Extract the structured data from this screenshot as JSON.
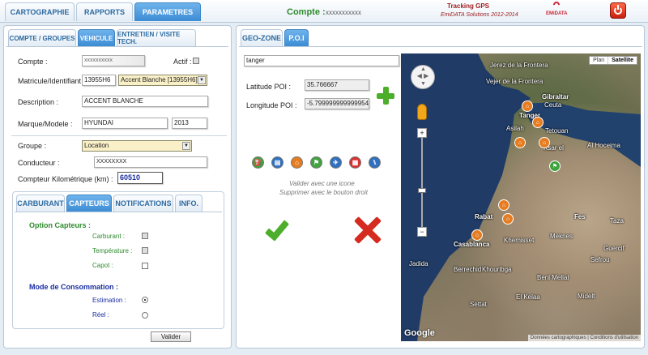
{
  "nav": {
    "tabs": [
      "CARTOGRAPHIE",
      "RAPPORTS",
      "PARAMETRES"
    ],
    "compte_label": "Compte :",
    "compte_value": "xxxxxxxxxxx",
    "tracking_title": "Tracking GPS",
    "tracking_sub": "EmiDATA Solutions 2012-2014",
    "logo_text": "EMiDATA"
  },
  "left": {
    "tabs": [
      "COMPTE / GROUPES",
      "VEHICULE",
      "ENTRETIEN / VISITE TECH."
    ],
    "compte_label": "Compte :",
    "compte_value": "xxxxxxxxxx",
    "actif_label": "Actif :",
    "matricule_label": "Matricule/Identifiant :",
    "matricule_value": "13955H6",
    "vehicule_select": "Accent Blanche [13955H6]",
    "description_label": "Description :",
    "description_value": "ACCENT BLANCHE",
    "marque_label": "Marque/Modele :",
    "marque_value": "HYUNDAI",
    "annee_value": "2013",
    "groupe_label": "Groupe :",
    "groupe_value": "Location",
    "conducteur_label": "Conducteur :",
    "conducteur_value": "XXXXXXXX",
    "compteur_label": "Compteur Kilométrique (km) :",
    "compteur_value": "60510",
    "subtabs": [
      "CARBURANT",
      "CAPTEURS",
      "NOTIFICATIONS",
      "INFO."
    ],
    "option_title": "Option Capteurs :",
    "capteurs": [
      "Carburant :",
      "Température :",
      "Capot :"
    ],
    "conso_title": "Mode de Consommation :",
    "modes": [
      "Estimation :",
      "Réel :"
    ],
    "valider": "Valider"
  },
  "right": {
    "tabs": [
      "GEO-ZONE",
      "P.O.I"
    ],
    "search_value": "tanger",
    "lat_label": "Latitude POI :",
    "lat_value": "35.766667",
    "lon_label": "Longitude POI :",
    "lon_value": "-5.7999999999999545",
    "hint1": "Valider avec une icone",
    "hint2": "Supprimer avec le bouton droit",
    "icon_colors": [
      "#3fa33f",
      "#2f6fc0",
      "#e67c1f",
      "#3fa33f",
      "#2f6fc0",
      "#d83030",
      "#2f6fc0"
    ]
  },
  "map": {
    "btn_plan": "Plan",
    "btn_satellite": "Satellite",
    "footer": "Données cartographiques",
    "footer2": "Conditions d'utilisation",
    "google": "Google",
    "cities": [
      {
        "name": "Jerez de la Frontera"
      },
      {
        "name": "Vejer de la Frontera"
      },
      {
        "name": "Gibraltar"
      },
      {
        "name": "Ceuta"
      },
      {
        "name": "Tanger"
      },
      {
        "name": "Tetouan"
      },
      {
        "name": "Asilah"
      },
      {
        "name": "Ksar el"
      },
      {
        "name": "Al Hoceima"
      },
      {
        "name": "Rabat"
      },
      {
        "name": "Fes"
      },
      {
        "name": "Meknes"
      },
      {
        "name": "Casablanca"
      },
      {
        "name": "Khemisset"
      },
      {
        "name": "Khouribga"
      },
      {
        "name": "Berrechid"
      },
      {
        "name": "Beni Mellal"
      },
      {
        "name": "Settat"
      },
      {
        "name": "Jadida"
      },
      {
        "name": "Midelt"
      },
      {
        "name": "Taza"
      },
      {
        "name": "Guercif"
      },
      {
        "name": "El Kelaa"
      },
      {
        "name": "Sefrou"
      }
    ]
  }
}
